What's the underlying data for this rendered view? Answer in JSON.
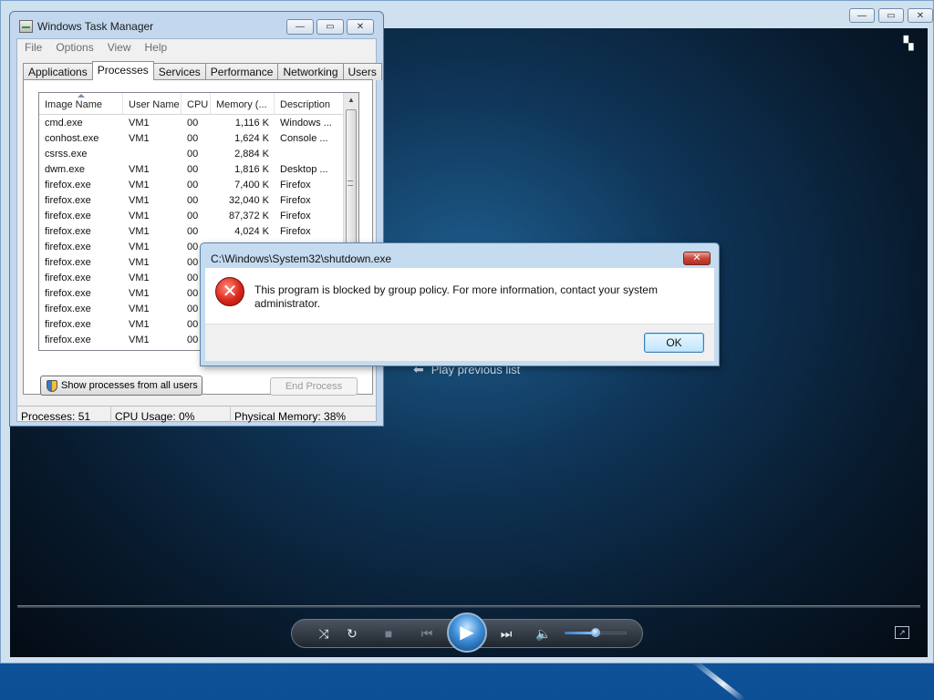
{
  "task_manager": {
    "title": "Windows Task Manager",
    "menu": [
      "File",
      "Options",
      "View",
      "Help"
    ],
    "tabs": [
      "Applications",
      "Processes",
      "Services",
      "Performance",
      "Networking",
      "Users"
    ],
    "active_tab": "Processes",
    "columns": [
      "Image Name",
      "User Name",
      "CPU",
      "Memory (...",
      "Description"
    ],
    "rows": [
      {
        "name": "cmd.exe",
        "user": "VM1",
        "cpu": "00",
        "mem": "1,116 K",
        "desc": "Windows ..."
      },
      {
        "name": "conhost.exe",
        "user": "VM1",
        "cpu": "00",
        "mem": "1,624 K",
        "desc": "Console ..."
      },
      {
        "name": "csrss.exe",
        "user": "",
        "cpu": "00",
        "mem": "2,884 K",
        "desc": ""
      },
      {
        "name": "dwm.exe",
        "user": "VM1",
        "cpu": "00",
        "mem": "1,816 K",
        "desc": "Desktop ..."
      },
      {
        "name": "firefox.exe",
        "user": "VM1",
        "cpu": "00",
        "mem": "7,400 K",
        "desc": "Firefox"
      },
      {
        "name": "firefox.exe",
        "user": "VM1",
        "cpu": "00",
        "mem": "32,040 K",
        "desc": "Firefox"
      },
      {
        "name": "firefox.exe",
        "user": "VM1",
        "cpu": "00",
        "mem": "87,372 K",
        "desc": "Firefox"
      },
      {
        "name": "firefox.exe",
        "user": "VM1",
        "cpu": "00",
        "mem": "4,024 K",
        "desc": "Firefox"
      },
      {
        "name": "firefox.exe",
        "user": "VM1",
        "cpu": "00",
        "mem": "",
        "desc": ""
      },
      {
        "name": "firefox.exe",
        "user": "VM1",
        "cpu": "00",
        "mem": "",
        "desc": ""
      },
      {
        "name": "firefox.exe",
        "user": "VM1",
        "cpu": "00",
        "mem": "",
        "desc": ""
      },
      {
        "name": "firefox.exe",
        "user": "VM1",
        "cpu": "00",
        "mem": "",
        "desc": ""
      },
      {
        "name": "firefox.exe",
        "user": "VM1",
        "cpu": "00",
        "mem": "",
        "desc": ""
      },
      {
        "name": "firefox.exe",
        "user": "VM1",
        "cpu": "00",
        "mem": "",
        "desc": ""
      },
      {
        "name": "firefox.exe",
        "user": "VM1",
        "cpu": "00",
        "mem": "",
        "desc": ""
      }
    ],
    "show_all_label": "Show processes from all users",
    "end_process_label": "End Process",
    "status": {
      "processes": "Processes: 51",
      "cpu": "CPU Usage: 0%",
      "memory": "Physical Memory: 38%"
    }
  },
  "dialog": {
    "title": "C:\\Windows\\System32\\shutdown.exe",
    "message": "This program is blocked by group policy. For more information, contact your system administrator.",
    "ok_label": "OK",
    "close_glyph": "✕"
  },
  "media_player": {
    "play_previous_label": "Play previous list",
    "volume_level": 0.5
  },
  "icons": {
    "minimize": "—",
    "maximize": "▭",
    "close": "✕",
    "error": "✕",
    "shuffle": "⤨",
    "repeat": "↻",
    "stop": "■",
    "previous": "⏮",
    "play": "▶",
    "next": "⏭",
    "volume": "🔈",
    "switch_view": "▚",
    "back_arrow": "⬅"
  }
}
